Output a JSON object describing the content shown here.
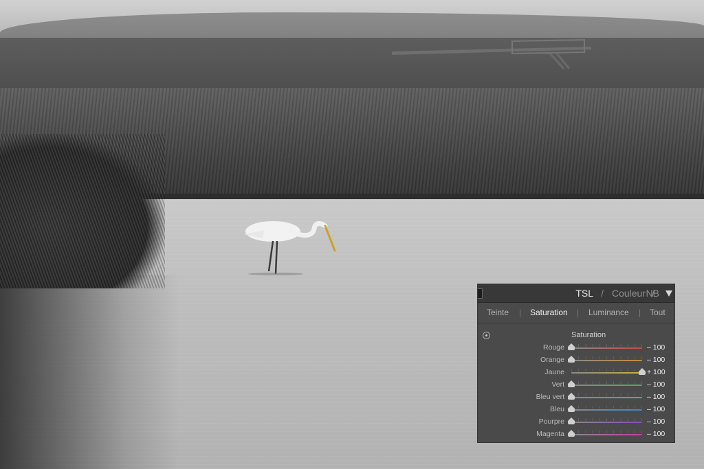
{
  "panel": {
    "header": {
      "modes": [
        "TSL",
        "Couleur",
        "NB"
      ],
      "separator": "/",
      "active_mode": "TSL"
    },
    "tabs": [
      {
        "label": "Teinte"
      },
      {
        "label": "Saturation",
        "active": true
      },
      {
        "label": "Luminance"
      },
      {
        "label": "Tout"
      }
    ],
    "tab_separator": "|",
    "section_title": "Saturation",
    "sliders": [
      {
        "label": "Rouge",
        "value": "– 100",
        "level": 0,
        "color": "#c84a4a"
      },
      {
        "label": "Orange",
        "value": "– 100",
        "level": 0,
        "color": "#c88a3c"
      },
      {
        "label": "Jaune",
        "value": "+ 100",
        "level": 1,
        "color": "#c9b437"
      },
      {
        "label": "Vert",
        "value": "– 100",
        "level": 0,
        "color": "#4bb04b"
      },
      {
        "label": "Bleu vert",
        "value": "– 100",
        "level": 0,
        "color": "#3fb0a8"
      },
      {
        "label": "Bleu",
        "value": "– 100",
        "level": 0,
        "color": "#3b86c8"
      },
      {
        "label": "Pourpre",
        "value": "– 100",
        "level": 0,
        "color": "#8a4bc0"
      },
      {
        "label": "Magenta",
        "value": "– 100",
        "level": 0,
        "color": "#c43fa6"
      }
    ]
  }
}
